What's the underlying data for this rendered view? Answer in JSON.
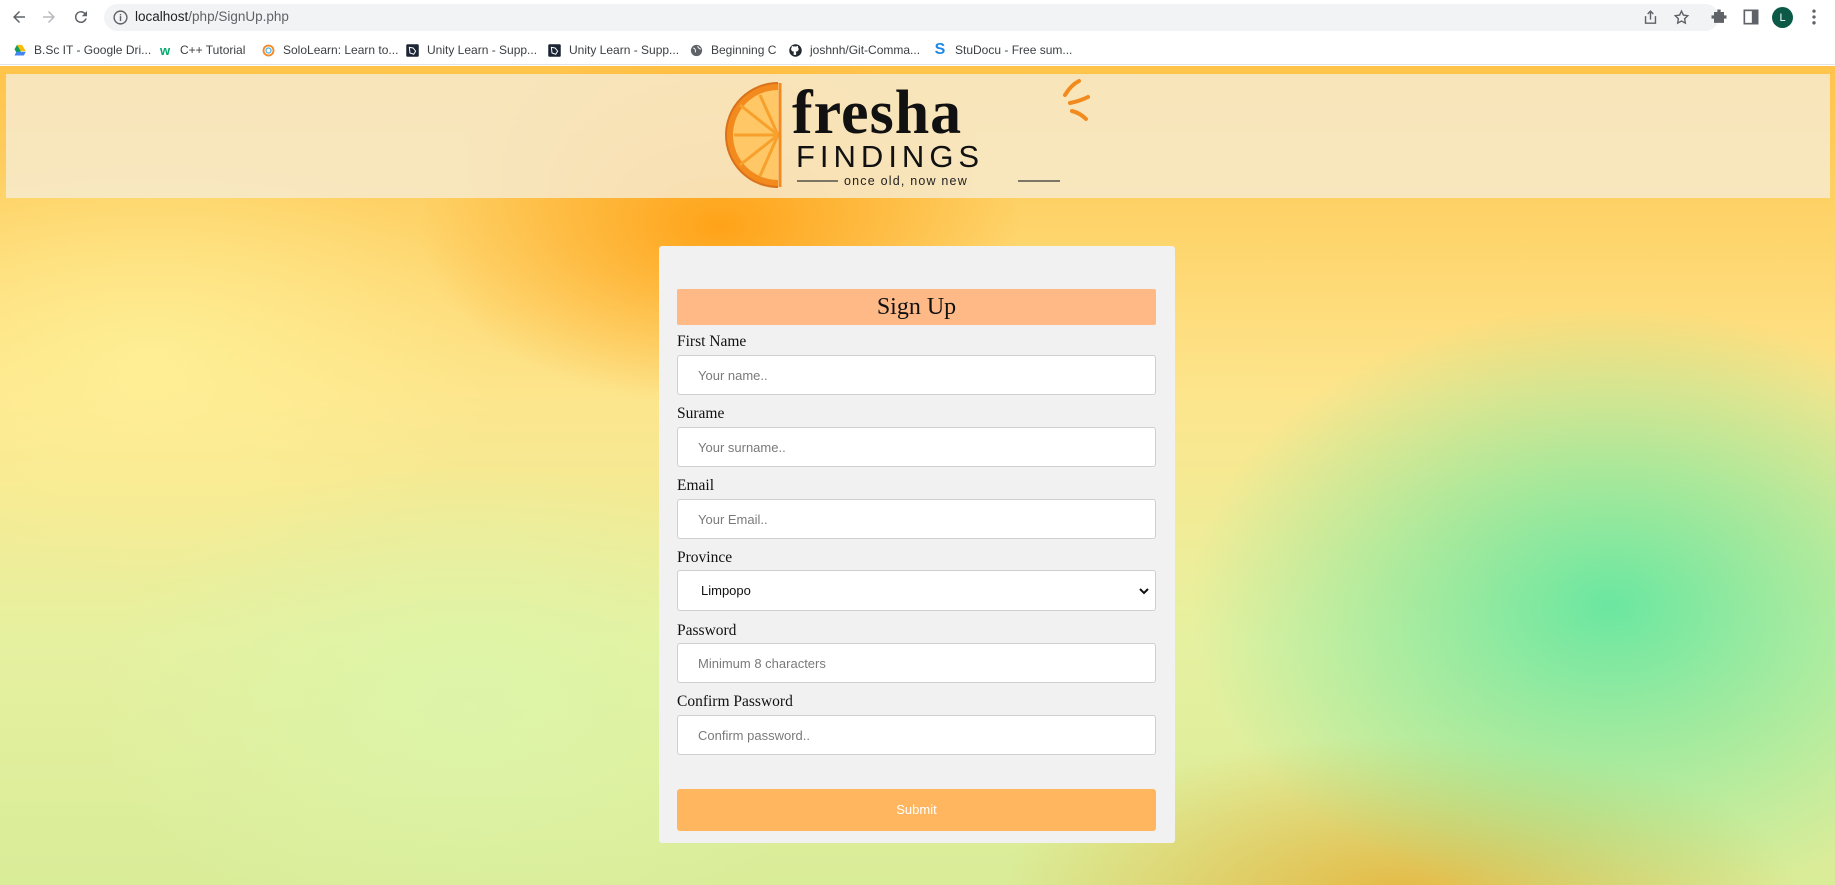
{
  "browser": {
    "url_host": "localhost",
    "url_path": "/php/SignUp.php",
    "profile_initial": "L",
    "bookmarks": [
      {
        "label": "B.Sc IT - Google Dri...",
        "icon": "google-drive-icon"
      },
      {
        "label": "C++ Tutorial",
        "icon": "w3schools-icon"
      },
      {
        "label": "SoloLearn: Learn to...",
        "icon": "sololearn-icon"
      },
      {
        "label": "Unity Learn - Supp...",
        "icon": "unity-icon"
      },
      {
        "label": "Unity Learn - Supp...",
        "icon": "unity-icon"
      },
      {
        "label": "Beginning C",
        "icon": "globe-icon"
      },
      {
        "label": "joshnh/Git-Comma...",
        "icon": "github-icon"
      },
      {
        "label": "StuDocu - Free sum...",
        "icon": "studocu-icon"
      }
    ]
  },
  "logo": {
    "word_top": "fresha",
    "word_bottom": "FINDINGS",
    "tagline": "once old, now new"
  },
  "form": {
    "title": "Sign Up",
    "first_name": {
      "label": "First Name",
      "placeholder": "Your name.."
    },
    "surname": {
      "label": "Surame",
      "placeholder": "Your surname.."
    },
    "email": {
      "label": "Email",
      "placeholder": "Your Email.."
    },
    "province": {
      "label": "Province",
      "selected": "Limpopo"
    },
    "password": {
      "label": "Password",
      "placeholder": "Minimum 8 characters"
    },
    "confirm_password": {
      "label": "Confirm Password",
      "placeholder": "Confirm password.."
    },
    "submit_label": "Submit"
  },
  "colors": {
    "title_bar": "#ffb986",
    "submit_button": "#ffb65f",
    "card": "#f1f1f1"
  }
}
